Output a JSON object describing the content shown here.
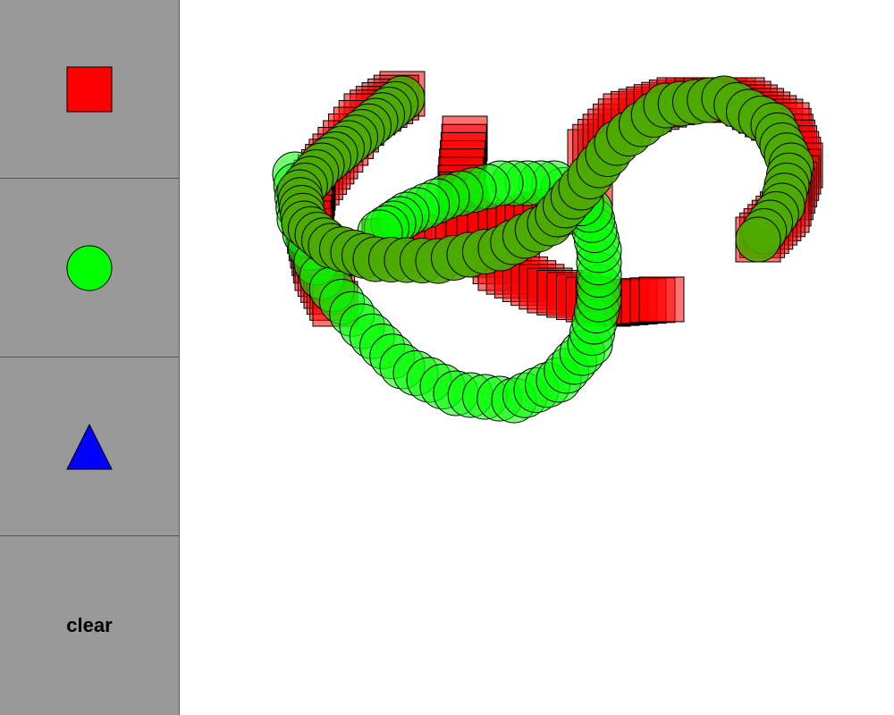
{
  "toolbar": {
    "tools": [
      {
        "icon": "square-icon",
        "color": "#ff0000"
      },
      {
        "icon": "circle-icon",
        "color": "#00ff00"
      },
      {
        "icon": "triangle-icon",
        "color": "#0000ff"
      },
      {
        "label": "clear"
      }
    ]
  },
  "canvas": {
    "shape_colors": {
      "square": "#ff0000",
      "circle": "#00ff00",
      "overlap_circle": "#4caa00"
    }
  }
}
